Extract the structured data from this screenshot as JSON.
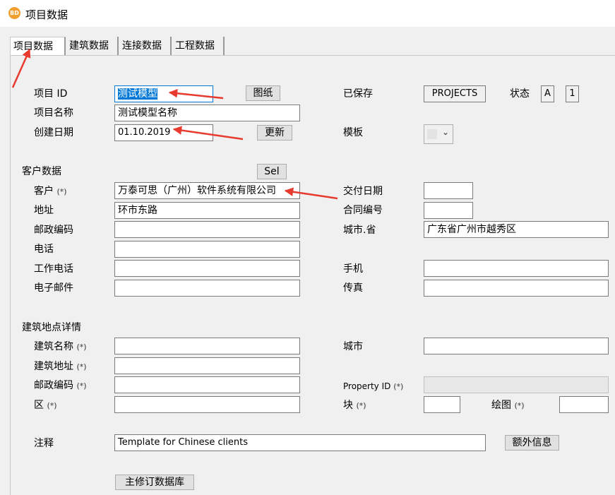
{
  "window": {
    "icon_text": "BD",
    "title": "项目数据"
  },
  "tabs": [
    "项目数据",
    "建筑数据",
    "连接数据",
    "工程数据"
  ],
  "project": {
    "id_label": "项目 ID",
    "id_value": "测试模型",
    "drawing_button": "图纸",
    "name_label": "项目名称",
    "name_value": "测试模型名称",
    "date_label": "创建日期",
    "date_value": "01.10.2019",
    "update_button": "更新",
    "saved_label": "已保存",
    "saved_value": "PROJECTS",
    "status_label": "状态",
    "status_a": "A",
    "status_1": "1",
    "template_label": "模板"
  },
  "customer": {
    "section_label": "客户数据",
    "sel_button": "Sel",
    "client_label": "客户",
    "client_value": "万泰可思（广州）软件系统有限公司",
    "address_label": "地址",
    "address_value": "环市东路",
    "postcode_label": "邮政编码",
    "postcode_value": "",
    "phone_label": "电话",
    "work_phone_label": "工作电话",
    "email_label": "电子邮件",
    "delivery_date_label": "交付日期",
    "contract_no_label": "合同编号",
    "city_province_label": "城市.省",
    "city_province_value": "广东省广州市越秀区",
    "mobile_label": "手机",
    "fax_label": "传真"
  },
  "site": {
    "section_label": "建筑地点详情",
    "building_name_label": "建筑名称",
    "building_address_label": "建筑地址",
    "postcode_label": "邮政编码",
    "district_label": "区",
    "city_label": "城市",
    "property_id_label": "Property ID",
    "block_label": "块",
    "plot_label": "绘图"
  },
  "required_marker": "(*)",
  "notes": {
    "label": "注释",
    "value": "Template for Chinese clients",
    "extra_button": "额外信息"
  },
  "master_db_button": "主修订数据库",
  "annotation_color": "#e83a2e"
}
